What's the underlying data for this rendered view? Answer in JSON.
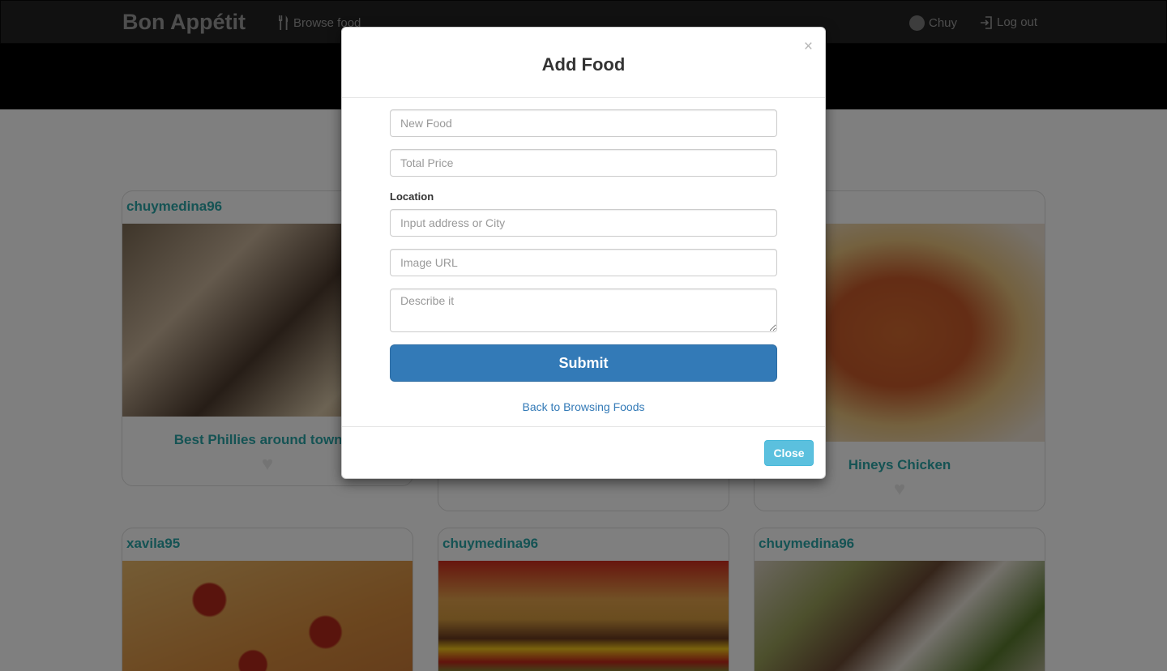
{
  "navbar": {
    "brand": "Bon Appétit",
    "browse_label": "Browse food",
    "user_label": "Chuy",
    "logout_label": "Log out"
  },
  "cards": [
    {
      "user": "chuymedina96",
      "title": "Best Phillies around town!!!!",
      "image": "philly-sandwich-photo"
    },
    {
      "user": "",
      "title": "",
      "image": "hidden-under-modal"
    },
    {
      "user": "",
      "title": "Hineys Chicken",
      "image": "chicken-fries-photo"
    },
    {
      "user": "xavila95",
      "title": "",
      "image": "pepperoni-pizza-photo"
    },
    {
      "user": "chuymedina96",
      "title": "",
      "image": "cheeseburger-photo"
    },
    {
      "user": "chuymedina96",
      "title": "",
      "image": "tacos-photo"
    }
  ],
  "modal": {
    "title": "Add Food",
    "close_x": "×",
    "new_food_placeholder": "New Food",
    "total_price_placeholder": "Total Price",
    "location_label": "Location",
    "location_placeholder": "Input address or City",
    "image_url_placeholder": "Image URL",
    "describe_placeholder": "Describe it",
    "submit_label": "Submit",
    "back_link": "Back to Browsing Foods",
    "close_label": "Close"
  },
  "colors": {
    "navbar_bg": "#222222",
    "accent_teal": "#2aa7a8",
    "primary_button": "#337ab7",
    "info_button": "#5bc0de"
  },
  "icons": [
    "cutlery-icon",
    "avatar-icon",
    "logout-icon",
    "heart-icon",
    "close-icon"
  ]
}
